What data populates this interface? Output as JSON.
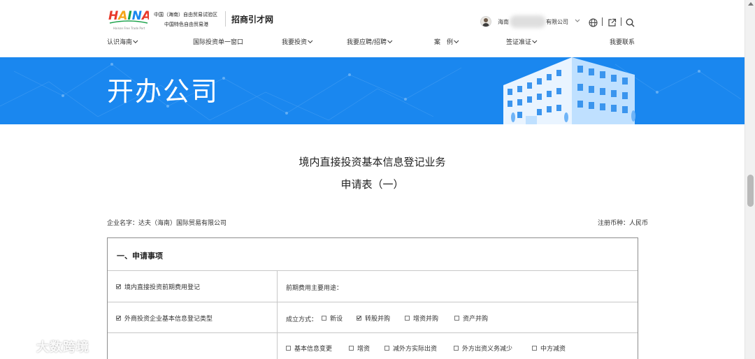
{
  "header": {
    "logo_text": "HAINAN",
    "logo_sub": "Hainan Free Trade Port",
    "org_line_1": "中国（海南）自由贸易试验区",
    "org_line_2": "中国特色自由贸易港",
    "site_title": "招商引才网",
    "user": {
      "name_prefix": "海南",
      "name_suffix": "有限公司"
    },
    "icons": [
      "globe-icon",
      "external-link-icon",
      "search-icon"
    ]
  },
  "nav": {
    "items": [
      {
        "label": "认识海南",
        "dropdown": true
      },
      {
        "label": "国际投资单一窗口",
        "dropdown": false
      },
      {
        "label": "我要投资",
        "dropdown": true
      },
      {
        "label": "我要应聘/招聘",
        "dropdown": true
      },
      {
        "label": "案　例",
        "dropdown": true
      },
      {
        "label": "签证准证",
        "dropdown": true
      },
      {
        "label": "我要联系",
        "dropdown": false
      }
    ]
  },
  "banner": {
    "title": "开办公司"
  },
  "form": {
    "title": "境内直接投资基本信息登记业务",
    "subtitle": "申请表（一）",
    "company_label": "企业名字：达夫（海南）国际贸易有限公司",
    "currency_label": "注册币种：人民币",
    "section_title": "一、申请事项",
    "rows": [
      {
        "left": {
          "label": "境内直接投资前期费用登记",
          "checked": true
        },
        "right_label": "前期费用主要用途："
      },
      {
        "left": {
          "label": "外商投资企业基本信息登记类型",
          "checked": true
        },
        "right_prefix": "成立方式：",
        "options": [
          {
            "label": "新设",
            "checked": false
          },
          {
            "label": "转股并购",
            "checked": true
          },
          {
            "label": "增资并购",
            "checked": false
          },
          {
            "label": "资产并购",
            "checked": false
          }
        ]
      },
      {
        "options_line_1": [
          {
            "label": "基本信息变更",
            "checked": false
          },
          {
            "label": "增资",
            "checked": false
          },
          {
            "label": "减外方实际出资",
            "checked": false
          },
          {
            "label": "外方出资义务减少",
            "checked": false
          },
          {
            "label": "中方减资",
            "checked": false
          }
        ]
      }
    ]
  },
  "watermark": "大数跨境",
  "scrollbar": {
    "position": 0.58
  }
}
